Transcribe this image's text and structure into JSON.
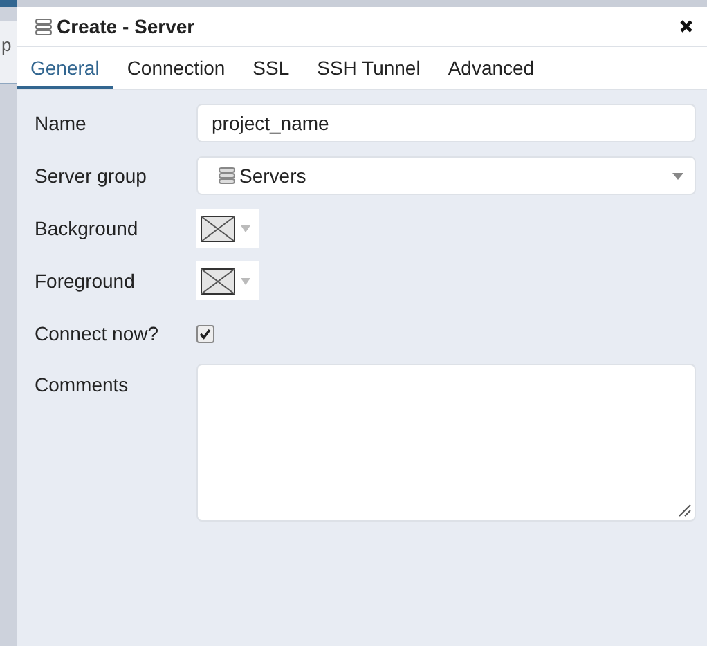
{
  "background_app": {
    "text": "p"
  },
  "window": {
    "title": "Create - Server"
  },
  "tabs": [
    {
      "label": "General",
      "selected": true
    },
    {
      "label": "Connection",
      "selected": false
    },
    {
      "label": "SSL",
      "selected": false
    },
    {
      "label": "SSH Tunnel",
      "selected": false
    },
    {
      "label": "Advanced",
      "selected": false
    }
  ],
  "fields": [
    {
      "kind": "text",
      "label": "Name",
      "value": "project_name"
    },
    {
      "kind": "select",
      "label": "Server group",
      "value": "Servers"
    },
    {
      "kind": "color",
      "label": "Background"
    },
    {
      "kind": "color",
      "label": "Foreground"
    },
    {
      "kind": "checkbox",
      "label": "Connect now?",
      "checked": true
    },
    {
      "kind": "textarea",
      "label": "Comments"
    }
  ]
}
